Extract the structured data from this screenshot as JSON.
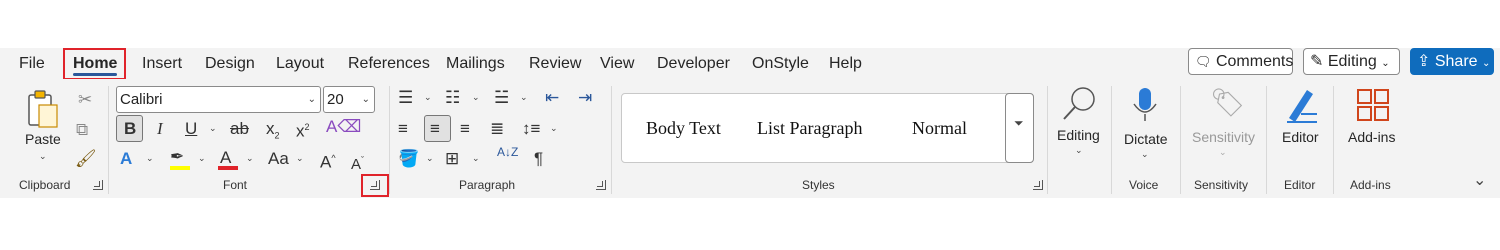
{
  "tabs": [
    {
      "label": "File"
    },
    {
      "label": "Home"
    },
    {
      "label": "Insert"
    },
    {
      "label": "Design"
    },
    {
      "label": "Layout"
    },
    {
      "label": "References"
    },
    {
      "label": "Mailings"
    },
    {
      "label": "Review"
    },
    {
      "label": "View"
    },
    {
      "label": "Developer"
    },
    {
      "label": "OnStyle"
    },
    {
      "label": "Help"
    }
  ],
  "topbar": {
    "comments_label": "Comments",
    "editing_label": "Editing",
    "share_label": "Share"
  },
  "clipboard": {
    "paste_label": "Paste",
    "group_label": "Clipboard"
  },
  "font": {
    "name_value": "Calibri",
    "size_value": "20",
    "bold": "B",
    "italic": "I",
    "underline": "U",
    "strikethrough": "ab",
    "subscript": "x",
    "superscript": "x",
    "case_label": "Aa",
    "grow_label": "A",
    "shrink_label": "A",
    "effects_label": "A",
    "color_label": "A",
    "group_label": "Font"
  },
  "paragraph": {
    "sort_label": "A↓Z",
    "group_label": "Paragraph"
  },
  "styles": {
    "items": [
      "Body Text",
      "List Paragraph",
      "Normal"
    ],
    "group_label": "Styles"
  },
  "editing": {
    "label": "Editing"
  },
  "voice": {
    "dictate_label": "Dictate",
    "group_label": "Voice"
  },
  "sensitivity": {
    "label": "Sensitivity",
    "group_label": "Sensitivity"
  },
  "editor": {
    "label": "Editor",
    "group_label": "Editor"
  },
  "addins": {
    "label": "Add-ins",
    "group_label": "Add-ins"
  },
  "colors": {
    "accent": "#2b579a",
    "share": "#0f6cbd",
    "highlight": "#ffff00",
    "font_color": "#e0232a",
    "annotation_red": "#e0232a"
  }
}
